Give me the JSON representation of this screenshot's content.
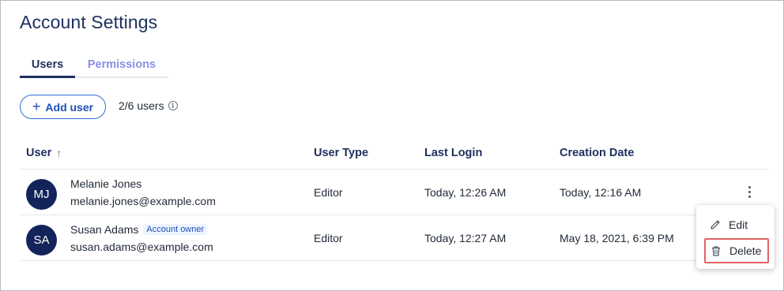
{
  "page": {
    "title": "Account Settings"
  },
  "tabs": [
    {
      "label": "Users",
      "active": true
    },
    {
      "label": "Permissions",
      "active": false
    }
  ],
  "toolbar": {
    "add_user_label": "Add user",
    "add_user_icon": "plus-icon",
    "user_count": "2/6 users",
    "info_icon": "info-icon"
  },
  "table": {
    "columns": [
      "User",
      "User Type",
      "Last Login",
      "Creation Date"
    ],
    "sort_icon": "arrow-up-icon",
    "rows": [
      {
        "initials": "MJ",
        "name": "Melanie Jones",
        "badge": "",
        "email": "melanie.jones@example.com",
        "user_type": "Editor",
        "last_login": "Today, 12:26 AM",
        "creation_date": "Today, 12:16 AM"
      },
      {
        "initials": "SA",
        "name": "Susan Adams",
        "badge": "Account owner",
        "email": "susan.adams@example.com",
        "user_type": "Editor",
        "last_login": "Today, 12:27 AM",
        "creation_date": "May 18, 2021, 6:39 PM"
      }
    ]
  },
  "context_menu": {
    "items": [
      {
        "label": "Edit",
        "icon": "pencil-icon"
      },
      {
        "label": "Delete",
        "icon": "trash-icon",
        "highlighted": true
      }
    ]
  },
  "colors": {
    "title": "#1d2f5e",
    "accent": "#2d6fd6",
    "avatar": "#13245a",
    "highlight_border": "#e26363"
  }
}
